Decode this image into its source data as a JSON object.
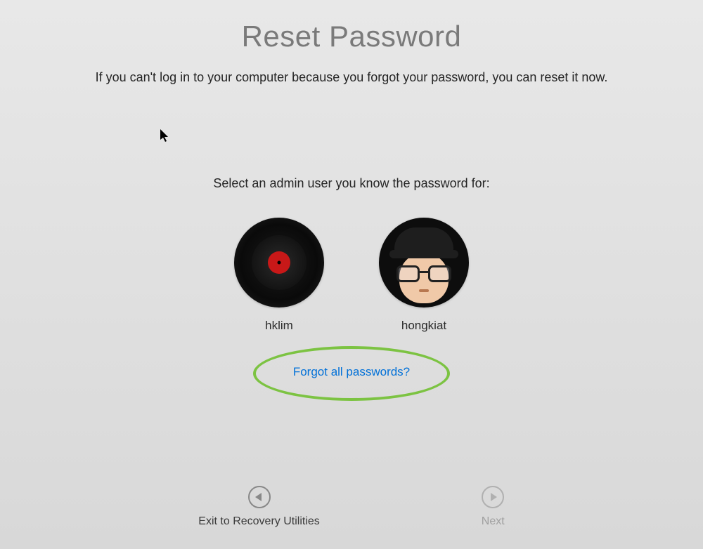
{
  "header": {
    "title": "Reset Password",
    "subtitle": "If you can't log in to your computer because you forgot your password, you can reset it now."
  },
  "main": {
    "select_label": "Select an admin user you know the password for:",
    "users": [
      {
        "name": "hklim",
        "avatar_type": "vinyl-record"
      },
      {
        "name": "hongkiat",
        "avatar_type": "memoji-hat-glasses"
      }
    ],
    "forgot_link": "Forgot all passwords?"
  },
  "footer": {
    "back_label": "Exit to Recovery Utilities",
    "next_label": "Next",
    "next_enabled": false
  },
  "annotation": {
    "highlight_color": "#7cc342"
  }
}
